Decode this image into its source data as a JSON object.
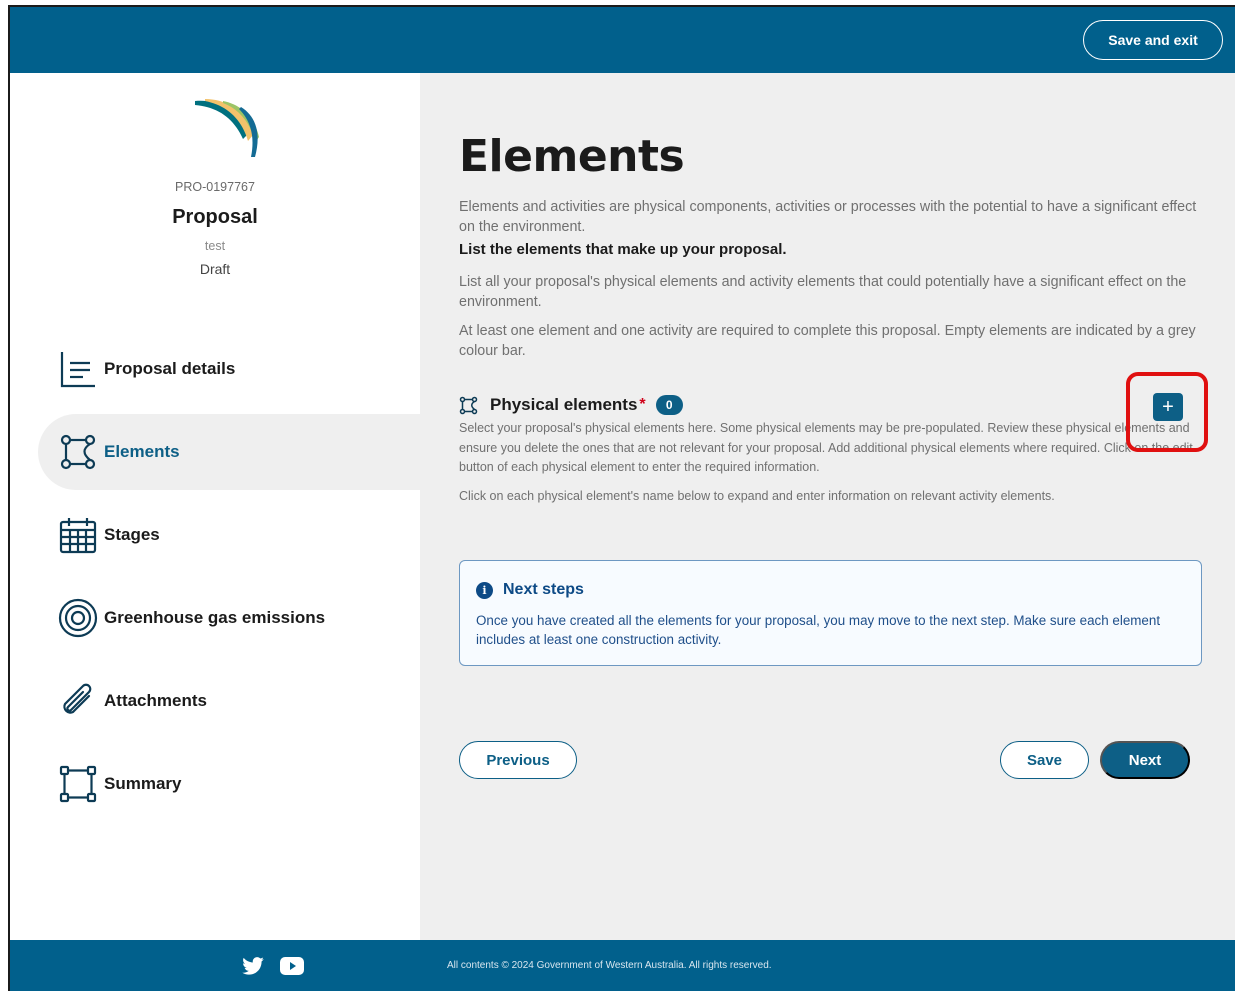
{
  "header": {
    "save_exit_label": "Save and exit"
  },
  "proposal": {
    "id": "PRO-0197767",
    "title": "Proposal",
    "subtitle": "test",
    "status": "Draft"
  },
  "nav": {
    "items": [
      {
        "label": "Proposal details",
        "icon": "list-icon"
      },
      {
        "label": "Elements",
        "icon": "elements-icon",
        "active": true
      },
      {
        "label": "Stages",
        "icon": "calendar-icon"
      },
      {
        "label": "Greenhouse gas emissions",
        "icon": "target-icon"
      },
      {
        "label": "Attachments",
        "icon": "paperclip-icon"
      },
      {
        "label": "Summary",
        "icon": "summary-icon"
      }
    ]
  },
  "main": {
    "title": "Elements",
    "intro": "Elements and activities are physical components, activities or processes with the potential to have a significant effect on the environment.",
    "subheading": "List the elements that make up your proposal.",
    "para1": "List all your proposal's physical elements and activity elements that could potentially have a significant effect on the environment.",
    "para2": "At least one element and one activity are required to complete this proposal. Empty elements are indicated by a grey colour bar.",
    "section": {
      "title": "Physical elements",
      "required_mark": "*",
      "count": "0",
      "add_label": "+",
      "desc1": "Select your proposal's physical elements here. Some physical elements may be pre-populated. Review these physical elements and ensure you delete the ones that are not relevant for your proposal. Add additional physical elements where required. Click on the edit button of each physical element to enter the required information.",
      "desc2": "Click on each physical element's name below to expand and enter information on relevant activity elements."
    },
    "info": {
      "icon": "i",
      "title": "Next steps",
      "text": "Once you have created all the elements for your proposal, you may move to the next step. Make sure each element includes at least one construction activity."
    },
    "buttons": {
      "previous": "Previous",
      "save": "Save",
      "next": "Next"
    }
  },
  "footer": {
    "copyright": "All contents © 2024 Government of Western Australia. All rights reserved.",
    "social": [
      "twitter-icon",
      "youtube-icon"
    ]
  },
  "colors": {
    "brand": "#01608c",
    "accent": "#0d5f86",
    "highlight": "#e01010"
  }
}
